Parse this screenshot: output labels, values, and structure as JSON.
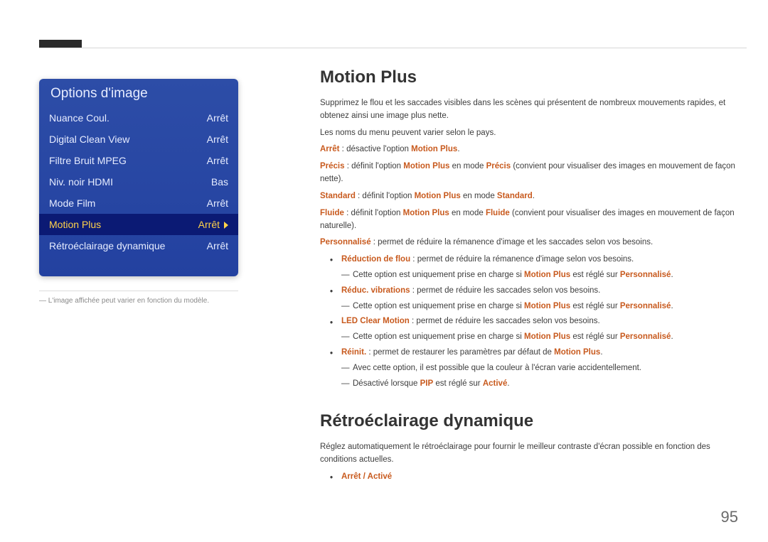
{
  "menu": {
    "title": "Options d'image",
    "items": [
      {
        "label": "Nuance Coul.",
        "value": "Arrêt",
        "selected": false
      },
      {
        "label": "Digital Clean View",
        "value": "Arrêt",
        "selected": false
      },
      {
        "label": "Filtre Bruit MPEG",
        "value": "Arrêt",
        "selected": false
      },
      {
        "label": "Niv. noir HDMI",
        "value": "Bas",
        "selected": false
      },
      {
        "label": "Mode Film",
        "value": "Arrêt",
        "selected": false
      },
      {
        "label": "Motion Plus",
        "value": "Arrêt",
        "selected": true
      },
      {
        "label": "Rétroéclairage dynamique",
        "value": "Arrêt",
        "selected": false
      }
    ],
    "caption": "L'image affichée peut varier en fonction du modèle."
  },
  "mp": {
    "title": "Motion Plus",
    "intro": "Supprimez le flou et les saccades visibles dans les scènes qui présentent de nombreux mouvements rapides, et obtenez ainsi une image plus nette.",
    "note_names": "Les noms du menu peuvent varier selon le pays.",
    "arret_l": "Arrêt",
    "arret_t": " : désactive l'option ",
    "arret_e": "Motion Plus",
    "arret_end": ".",
    "precis_l": "Précis",
    "precis_t1": " : définit l'option ",
    "precis_e1": "Motion Plus",
    "precis_t2": " en mode ",
    "precis_e2": "Précis",
    "precis_t3": " (convient pour visualiser des images en mouvement de façon nette).",
    "std_l": "Standard",
    "std_t1": " : définit l'option ",
    "std_e1": "Motion Plus",
    "std_t2": " en mode ",
    "std_e2": "Standard",
    "std_end": ".",
    "flu_l": "Fluide",
    "flu_t1": " : définit l'option ",
    "flu_e1": "Motion Plus",
    "flu_t2": " en mode ",
    "flu_e2": "Fluide",
    "flu_t3": " (convient pour visualiser des images en mouvement de façon naturelle).",
    "perso_l": "Personnalisé",
    "perso_t": " : permet de réduire la rémanence d'image et les saccades selon vos besoins.",
    "b1_l": "Réduction de flou",
    "b1_t": " : permet de réduire la rémanence d'image selon vos besoins.",
    "s1_t1": "Cette option est uniquement prise en charge si ",
    "s1_e1": "Motion Plus",
    "s1_t2": " est réglé sur ",
    "s1_e2": "Personnalisé",
    "s1_end": ".",
    "b2_l": "Réduc. vibrations",
    "b2_t": " : permet de réduire les saccades selon vos besoins.",
    "s2_t1": "Cette option est uniquement prise en charge si ",
    "s2_e1": "Motion Plus",
    "s2_t2": " est réglé sur ",
    "s2_e2": "Personnalisé",
    "s2_end": ".",
    "b3_l": "LED Clear Motion",
    "b3_t": " : permet de réduire les saccades selon vos besoins.",
    "s3_t1": "Cette option est uniquement prise en charge si ",
    "s3_e1": "Motion Plus",
    "s3_t2": " est réglé sur ",
    "s3_e2": "Personnalisé",
    "s3_end": ".",
    "b4_l": "Réinit.",
    "b4_t1": " : permet de restaurer les paramètres par défaut de ",
    "b4_e": "Motion Plus",
    "b4_end": ".",
    "s4a": "Avec cette option, il est possible que la couleur à l'écran varie accidentellement.",
    "s4b_t1": "Désactivé lorsque ",
    "s4b_e1": "PIP",
    "s4b_t2": " est réglé sur ",
    "s4b_e2": "Activé",
    "s4b_end": "."
  },
  "retro": {
    "title": "Rétroéclairage dynamique",
    "body": "Réglez automatiquement le rétroéclairage pour fournir le meilleur contraste d'écran possible en fonction des conditions actuelles.",
    "opts": "Arrêt / Activé"
  },
  "page_number": "95"
}
